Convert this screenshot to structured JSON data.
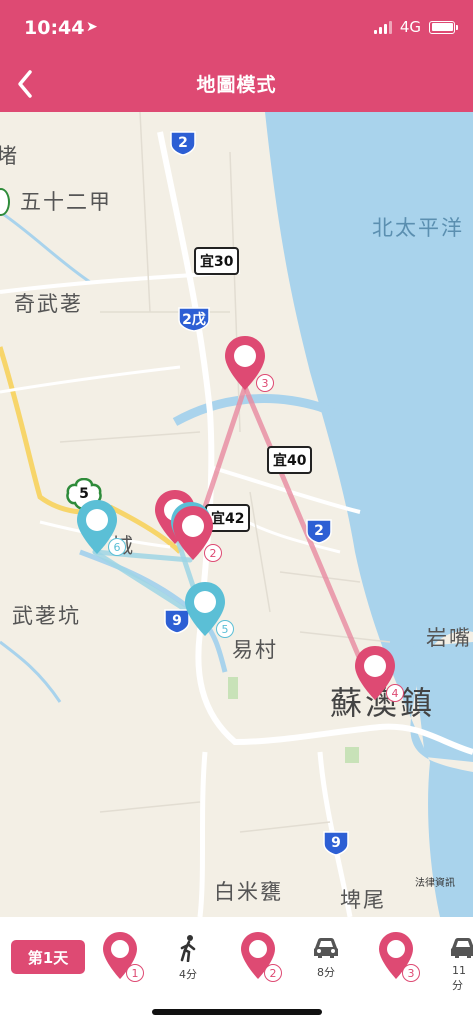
{
  "status": {
    "time": "10:44",
    "network": "4G",
    "location_icon": "location-arrow-icon"
  },
  "nav": {
    "back_icon": "chevron-left-icon",
    "title": "地圖模式"
  },
  "map": {
    "place_labels": [
      "五十二甲",
      "奇武荖",
      "北太平洋",
      "武荖坑",
      "易村",
      "岩嘴",
      "蘇澳鎮",
      "白米甕",
      "埤尾",
      "堵",
      "城"
    ],
    "road_signs": [
      "宜30",
      "宜40",
      "宜42"
    ],
    "highway_shields": [
      "2",
      "2戊",
      "2",
      "9",
      "9"
    ],
    "scenic_badge": "5",
    "legal": "法律資訊",
    "stops": [
      {
        "number": "1",
        "color": "#de4a73"
      },
      {
        "number": "2",
        "color": "#de4a73"
      },
      {
        "number": "3",
        "color": "#de4a73"
      },
      {
        "number": "4",
        "color": "#de4a73"
      },
      {
        "number": "5",
        "color": "#5bbfd6"
      },
      {
        "number": "6",
        "color": "#5bbfd6"
      }
    ]
  },
  "itinerary": {
    "day_label": "第1天",
    "items": [
      {
        "type": "stop",
        "number": "1"
      },
      {
        "type": "transport",
        "mode_icon": "walking-icon",
        "duration": "4分"
      },
      {
        "type": "stop",
        "number": "2"
      },
      {
        "type": "transport",
        "mode_icon": "car-icon",
        "duration": "8分"
      },
      {
        "type": "stop",
        "number": "3"
      },
      {
        "type": "transport",
        "mode_icon": "car-icon",
        "duration": "11分"
      }
    ]
  },
  "colors": {
    "primary": "#de4a73",
    "secondary": "#5bbfd6",
    "sea": "#a9d3ec",
    "land": "#f3efe5"
  }
}
